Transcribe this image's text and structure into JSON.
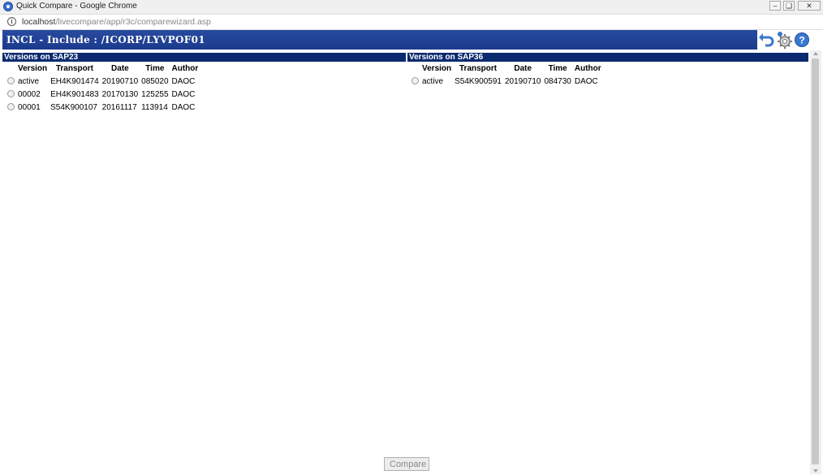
{
  "window": {
    "title": "Quick Compare - Google Chrome"
  },
  "address": {
    "host": "localhost",
    "path": "/livecompare/app/r3c/comparewizard.asp"
  },
  "header": {
    "title": "INCL - Include : /ICORP/LYVPOF01"
  },
  "icons": {
    "undo": "undo-icon",
    "settings": "gear-icon",
    "help": "help-icon",
    "accent": "#3a78d0"
  },
  "colors": {
    "header_bg": "#1f3f92",
    "panel_bg": "#0b2a6f"
  },
  "columns": [
    "Version",
    "Transport",
    "Date",
    "Time",
    "Author"
  ],
  "left": {
    "heading": "Versions on SAP23",
    "rows": [
      {
        "version": "active",
        "transport": "EH4K901474",
        "date": "20190710",
        "time": "085020",
        "author": "DAOC"
      },
      {
        "version": "00002",
        "transport": "EH4K901483",
        "date": "20170130",
        "time": "125255",
        "author": "DAOC"
      },
      {
        "version": "00001",
        "transport": "S54K900107",
        "date": "20161117",
        "time": "113914",
        "author": "DAOC"
      }
    ]
  },
  "right": {
    "heading": "Versions on SAP36",
    "rows": [
      {
        "version": "active",
        "transport": "S54K900591",
        "date": "20190710",
        "time": "084730",
        "author": "DAOC"
      }
    ]
  },
  "compare_label": "Compare"
}
